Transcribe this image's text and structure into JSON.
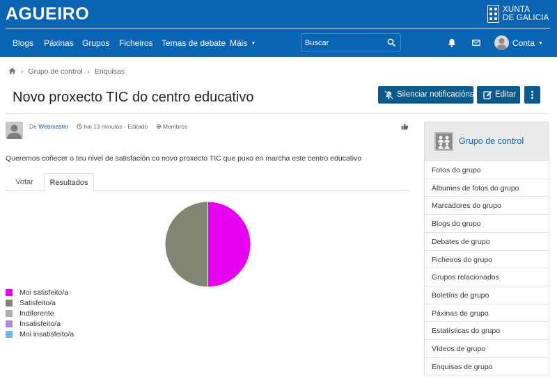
{
  "header": {
    "site_name": "AGUEIRO",
    "logo_line1": "XUNTA",
    "logo_line2": "DE GALICIA",
    "nav": [
      {
        "label": "Blogs"
      },
      {
        "label": "Páxinas"
      },
      {
        "label": "Grupos"
      },
      {
        "label": "Ficheiros"
      },
      {
        "label": "Temas de debate"
      },
      {
        "label": "Máis"
      }
    ],
    "search_placeholder": "Buscar",
    "account_label": "Conta"
  },
  "breadcrumb": [
    "Grupo de control",
    "Enquisas"
  ],
  "page": {
    "title": "Novo proxecto TIC do centro educativo",
    "buttons": {
      "mute": "Silenciar notificacións",
      "edit": "Editar"
    }
  },
  "post": {
    "author_prefix": "De",
    "author": "Webmaster",
    "time": "hai 13 minutos - Editado",
    "access": "Membros",
    "description": "Queremos coñecer o teu nivel de satisfación co novo proxecto TIC que puxo en marcha este centro educativo"
  },
  "tabs": [
    {
      "label": "Votar",
      "active": false
    },
    {
      "label": "Resultados",
      "active": true
    }
  ],
  "chart_data": {
    "type": "pie",
    "categories": [
      "Moi satisfeito/a",
      "Satisfeito/a",
      "Indiferente",
      "Insatisfeito/a",
      "Moi insatisfeito/a"
    ],
    "values": [
      50,
      50,
      0,
      0,
      0
    ],
    "colors": [
      "#e600f0",
      "#848472",
      "#a8b0b0",
      "#a88ce6",
      "#6ab8e6"
    ],
    "legend_position": "bottom-left"
  },
  "sidebar": {
    "title": "Grupo de control",
    "items": [
      {
        "label": "Fotos do grupo"
      },
      {
        "label": "Álbumes de fotos do grupo"
      },
      {
        "label": "Marcadores do grupo"
      },
      {
        "label": "Blogs do grupo"
      },
      {
        "label": "Debates de grupo"
      },
      {
        "label": "Ficheiros do grupo"
      },
      {
        "label": "Grupos relacionados"
      },
      {
        "label": "Boletíns de grupo"
      },
      {
        "label": "Páxinas de grupo"
      },
      {
        "label": "Estatísticas do grupo"
      },
      {
        "label": "Vídeos de grupo"
      },
      {
        "label": "Enquisas de grupo"
      }
    ]
  }
}
